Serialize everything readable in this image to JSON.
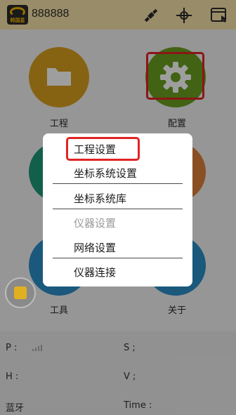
{
  "app": {
    "logo_text": "韩国星",
    "device_id": "888888"
  },
  "toolbar": {
    "satellite_icon": "satellite-icon",
    "crosshair_icon": "gps-crosshair-icon",
    "window_icon": "window-touch-icon"
  },
  "tiles": [
    {
      "label": "工程",
      "icon": "folder-icon",
      "color": "#d9a020"
    },
    {
      "label": "配置",
      "icon": "gear-icon",
      "color": "#6aa020"
    },
    {
      "label": "工具",
      "icon": "tool-icon",
      "color": "#2a8fc8"
    },
    {
      "label": "关于",
      "icon": "info-icon",
      "color": "#2a8fc8"
    }
  ],
  "status": {
    "p_label": "P :",
    "s_label": "S ;",
    "h_label": "H :",
    "v_label": "V ;",
    "bt_label": "蓝牙",
    "time_label": "Time :"
  },
  "menu": {
    "items": [
      {
        "label": "工程设置",
        "enabled": true
      },
      {
        "label": "坐标系统设置",
        "enabled": true
      },
      {
        "label": "坐标系统库",
        "enabled": true
      },
      {
        "label": "仪器设置",
        "enabled": false
      },
      {
        "label": "网络设置",
        "enabled": true
      },
      {
        "label": "仪器连接",
        "enabled": true
      }
    ]
  },
  "highlight_color": "#e02424"
}
